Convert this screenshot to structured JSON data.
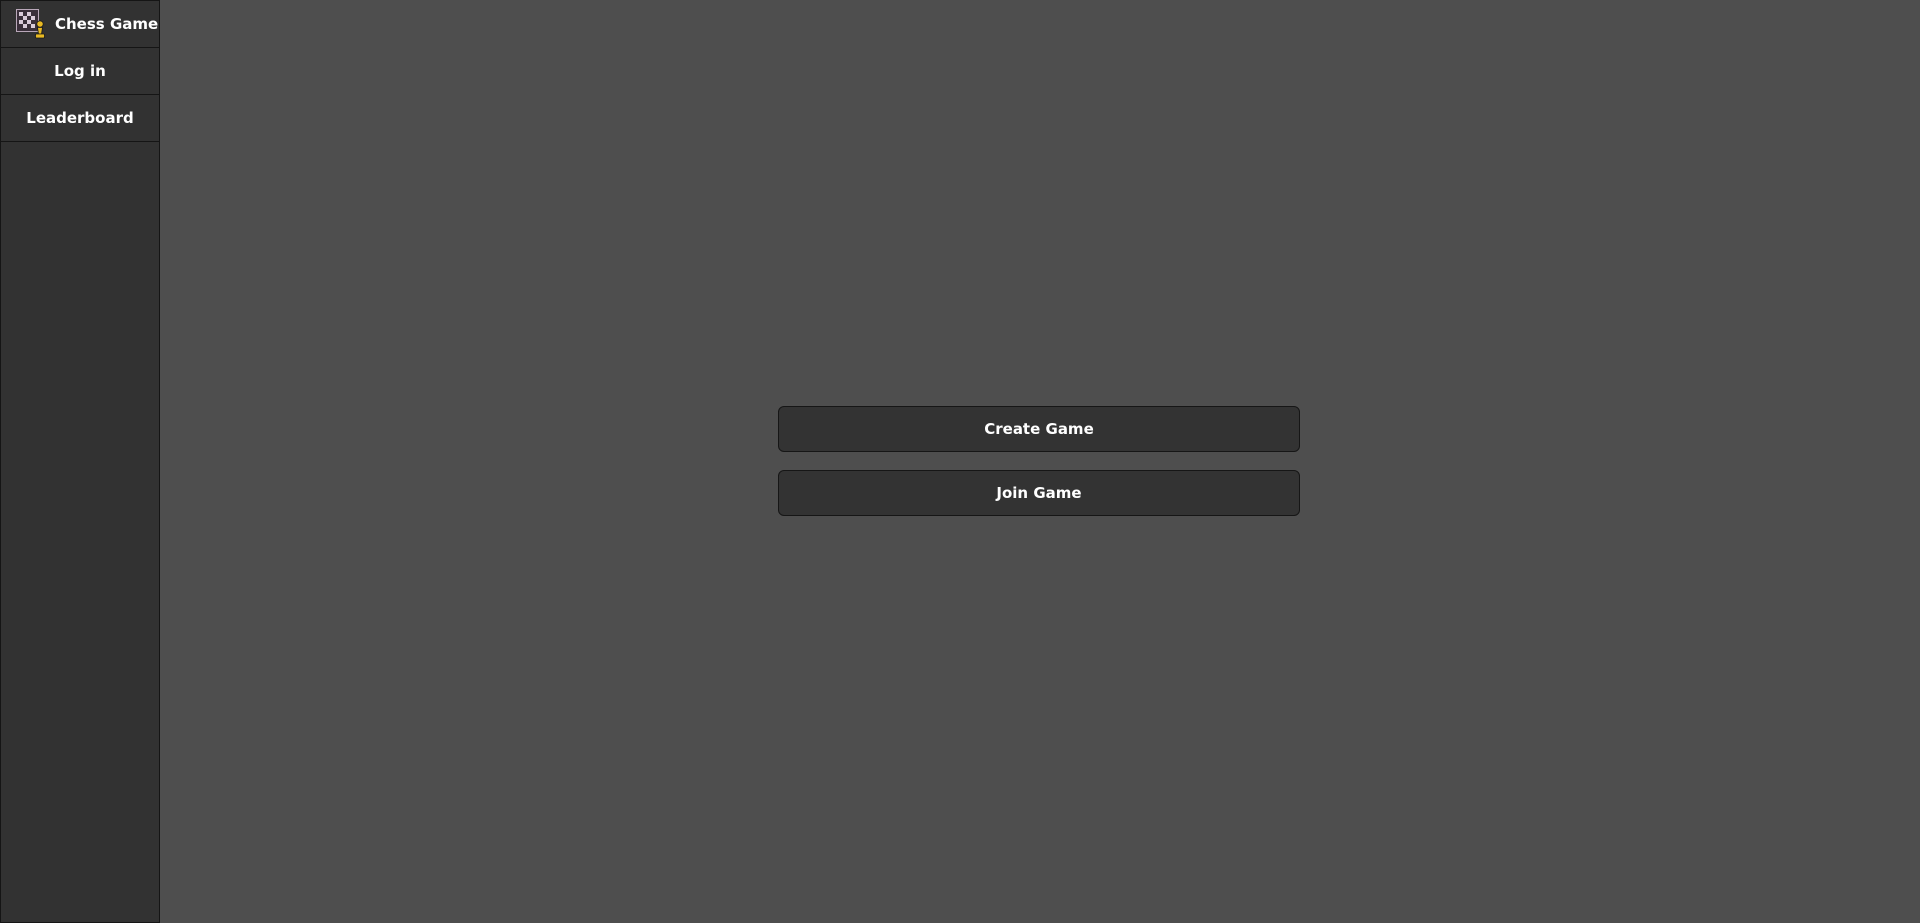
{
  "sidebar": {
    "brand": {
      "title": "Chess Game",
      "logo_icon": "chessboard-pawn-logo-icon"
    },
    "items": [
      {
        "label": "Log in"
      },
      {
        "label": "Leaderboard"
      }
    ]
  },
  "main": {
    "create_game_label": "Create Game",
    "join_game_label": "Join Game"
  },
  "colors": {
    "background": "#4e4e4e",
    "sidebar": "#323232",
    "button": "#333333",
    "border": "#151515",
    "text": "#ffffff",
    "logo_accent": "#e8b923"
  }
}
